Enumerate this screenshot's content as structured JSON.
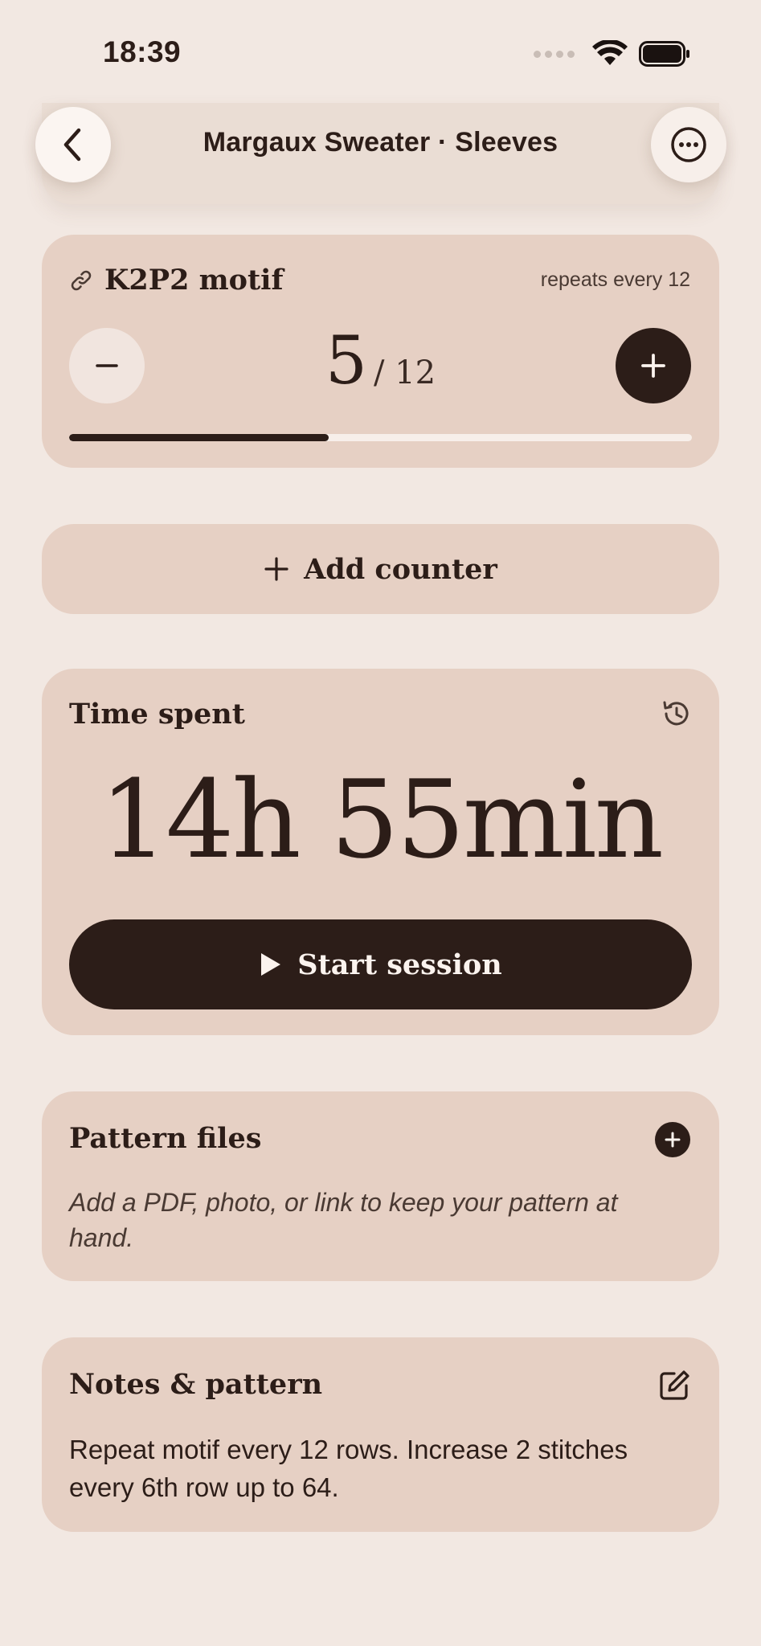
{
  "status_bar": {
    "time": "18:39"
  },
  "header": {
    "title": "Margaux Sweater · Sleeves",
    "back_icon": "chevron-left-icon",
    "more_icon": "ellipsis-circle-icon"
  },
  "counter": {
    "label": "K2P2 motif",
    "repeat_text": "repeats every 12",
    "current": "5",
    "total": "/ 12",
    "progress_fraction": 0.4167,
    "link_icon": "link-icon",
    "minus_icon": "minus-icon",
    "plus_icon": "plus-icon"
  },
  "add_counter": {
    "label": "Add counter"
  },
  "time_spent": {
    "label": "Time spent",
    "value": "14h 55min",
    "start_label": "Start session",
    "history_icon": "history-icon",
    "play_icon": "play-icon"
  },
  "pattern_files": {
    "title": "Pattern files",
    "description": "Add a PDF, photo, or link to keep your pattern at hand."
  },
  "notes": {
    "title": "Notes & pattern",
    "body": "Repeat motif every 12 rows. Increase 2 stitches every 6th row up to 64."
  },
  "colors": {
    "background": "#f2e8e2",
    "card": "#e6d0c4",
    "accent_dark": "#2c1d18"
  }
}
